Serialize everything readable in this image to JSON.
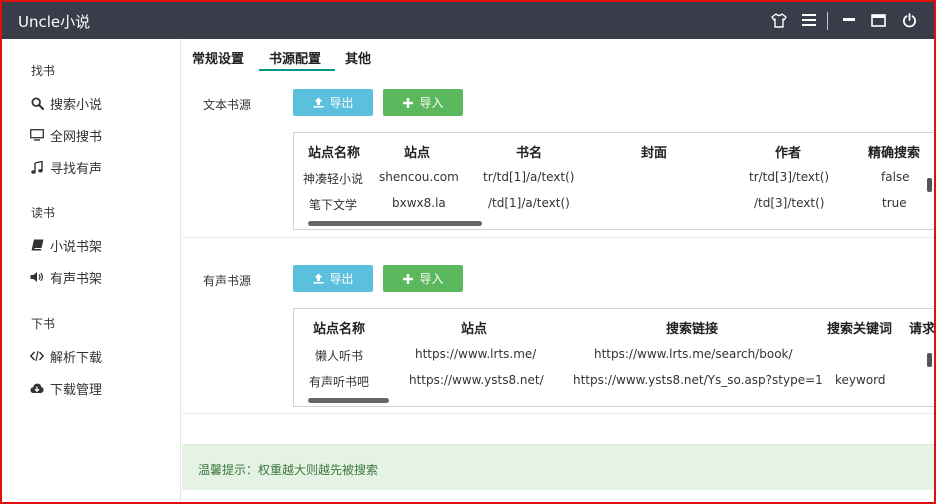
{
  "app": {
    "title": "Uncle小说"
  },
  "titlebar": {
    "icons": [
      "shirt-icon",
      "menu-icon",
      "minimize-icon",
      "maximize-icon",
      "power-icon"
    ]
  },
  "sidebar": {
    "groups": [
      {
        "label": "找书",
        "items": [
          {
            "label": "搜索小说",
            "icon": "search-icon"
          },
          {
            "label": "全网搜书",
            "icon": "monitor-icon"
          },
          {
            "label": "寻找有声",
            "icon": "music-icon"
          }
        ]
      },
      {
        "label": "读书",
        "items": [
          {
            "label": "小说书架",
            "icon": "book-icon"
          },
          {
            "label": "有声书架",
            "icon": "volume-icon"
          }
        ]
      },
      {
        "label": "下书",
        "items": [
          {
            "label": "解析下载",
            "icon": "code-icon"
          },
          {
            "label": "下载管理",
            "icon": "cloud-download-icon"
          }
        ]
      }
    ]
  },
  "tabs": [
    {
      "label": "常规设置"
    },
    {
      "label": "书源配置",
      "active": true
    },
    {
      "label": "其他"
    }
  ],
  "text_source": {
    "label": "文本书源",
    "export_label": "导出",
    "import_label": "导入",
    "columns": [
      "站点名称",
      "站点",
      "书名",
      "封面",
      "作者",
      "精确搜索"
    ],
    "rows": [
      [
        "神凑轻小说",
        "shencou.com",
        "tr/td[1]/a/text()",
        "",
        "tr/td[3]/text()",
        "false"
      ],
      [
        "笔下文学",
        "bxwx8.la",
        "/td[1]/a/text()",
        "",
        "/td[3]/text()",
        "true"
      ]
    ]
  },
  "audio_source": {
    "label": "有声书源",
    "export_label": "导出",
    "import_label": "导入",
    "columns": [
      "站点名称",
      "站点",
      "搜索链接",
      "搜索关键词",
      "请求"
    ],
    "rows": [
      [
        "懒人听书",
        "https://www.lrts.me/",
        "https://www.lrts.me/search/book/",
        "",
        ""
      ],
      [
        "有声听书吧",
        "https://www.ysts8.net/",
        "https://www.ysts8.net/Ys_so.asp?stype=1",
        "keyword",
        ""
      ]
    ]
  },
  "tip": {
    "text": "温馨提示：权重越大则越先被搜索"
  },
  "colors": {
    "titlebar": "#393d49",
    "export_button": "#5bc0de",
    "import_button": "#5cb85c",
    "tab_accent": "#009688",
    "tip_background": "#e5f3e5",
    "border": "#e01010"
  }
}
